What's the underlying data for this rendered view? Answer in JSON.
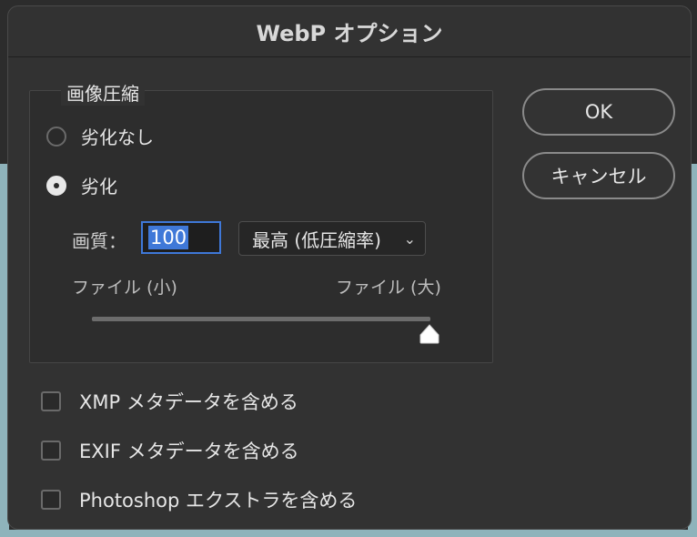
{
  "dialog": {
    "title": "WebP オプション"
  },
  "compression": {
    "group_label": "画像圧縮",
    "options": [
      {
        "label": "劣化なし",
        "checked": false
      },
      {
        "label": "劣化",
        "checked": true
      }
    ],
    "quality_label": "画質：",
    "quality_value": "100",
    "quality_preset": "最高 (低圧縮率)",
    "slider_min_label": "ファイル (小)",
    "slider_max_label": "ファイル (大)",
    "slider_value": 100
  },
  "buttons": {
    "ok": "OK",
    "cancel": "キャンセル"
  },
  "metadata": {
    "items": [
      {
        "label": "XMP メタデータを含める",
        "checked": false
      },
      {
        "label": "EXIF メタデータを含める",
        "checked": false
      },
      {
        "label": "Photoshop エクストラを含める",
        "checked": false
      }
    ]
  },
  "colors": {
    "accent": "#3f78d8",
    "background": "#323232"
  }
}
